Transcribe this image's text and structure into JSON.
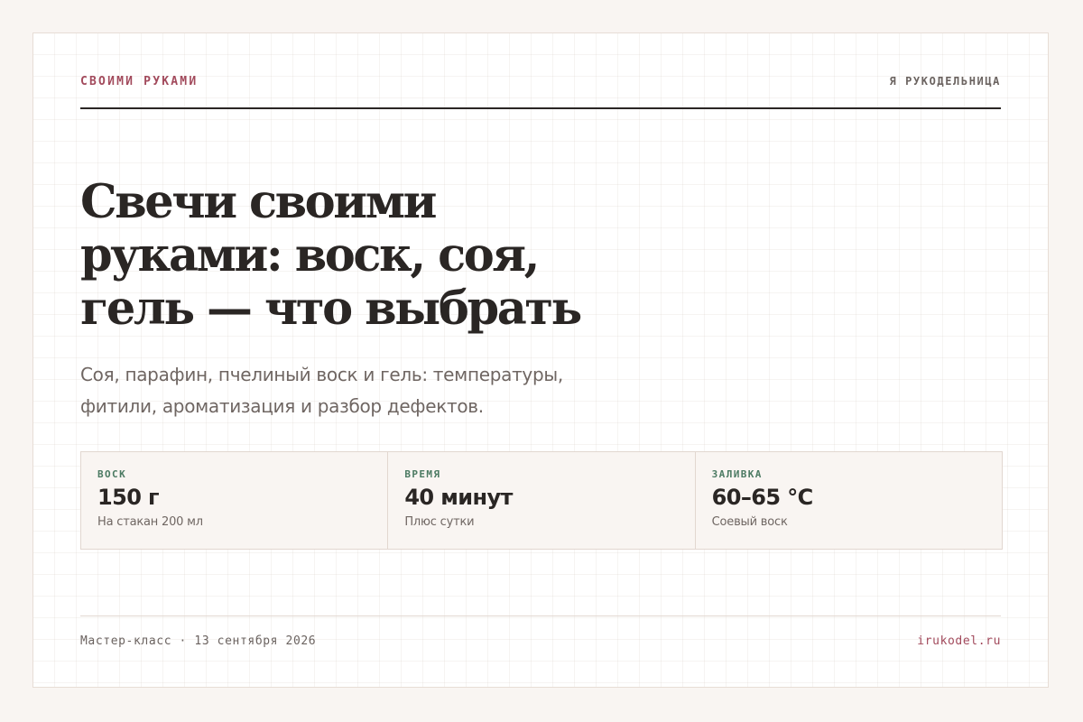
{
  "header": {
    "brand": "СВОИМИ РУКАМИ",
    "section": "Я РУКОДЕЛЬНИЦА"
  },
  "article": {
    "title": "Свечи своими руками: воск, соя, гель — что выбрать",
    "subtitle": "Соя, парафин, пчелиный воск и гель: температуры, фитили, ароматизация и разбор дефектов."
  },
  "stats": [
    {
      "label": "ВОСК",
      "value": "150 г",
      "note": "На стакан 200 мл"
    },
    {
      "label": "ВРЕМЯ",
      "value": "40 минут",
      "note": "Плюс сутки"
    },
    {
      "label": "ЗАЛИВКА",
      "value": "60–65 °C",
      "note": "Соевый воск"
    }
  ],
  "footer": {
    "date": "Мастер-класс · 13 сентября 2026",
    "url": "irukodel.ru"
  },
  "colors": {
    "accent": "#a24a5c",
    "label_green": "#4b7a62",
    "text": "#2a2624",
    "muted": "#6f6662",
    "background": "#f9f5f2"
  }
}
